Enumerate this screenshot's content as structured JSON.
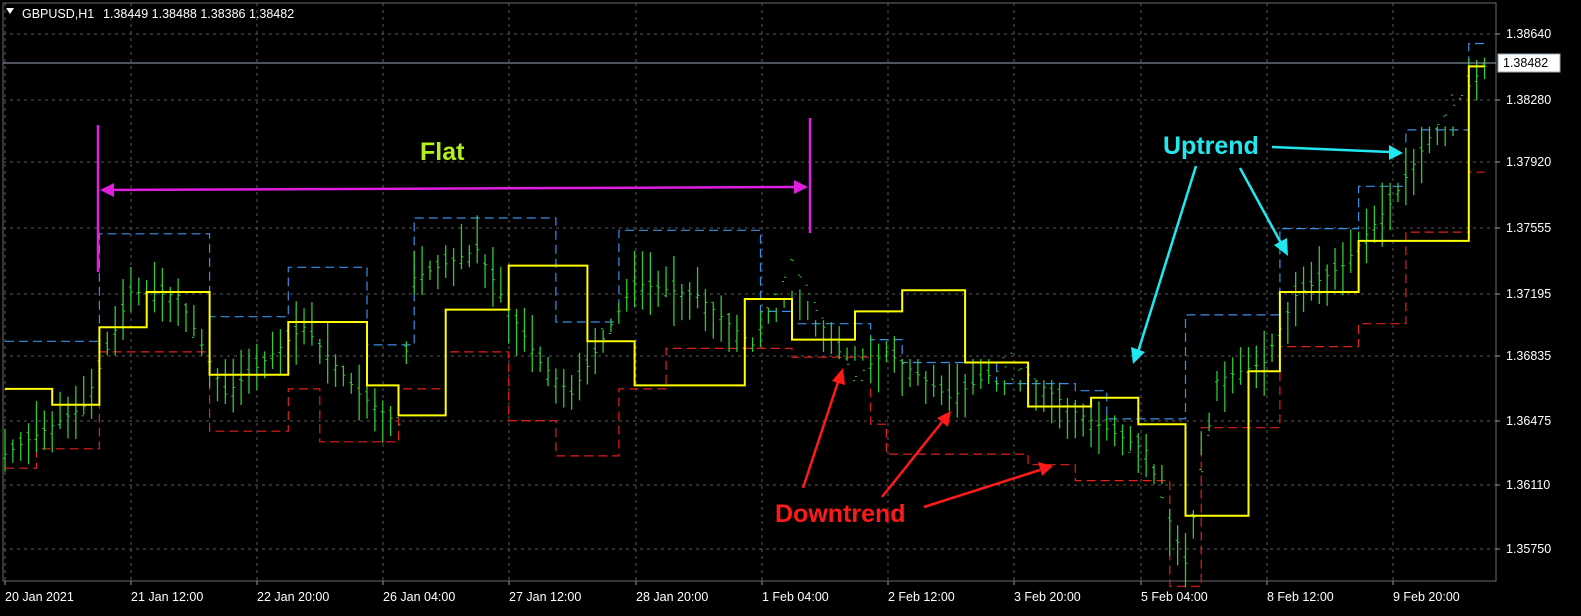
{
  "header": {
    "symbol": "GBPUSD,H1",
    "ohlc": "1.38449 1.38488 1.38386 1.38482"
  },
  "colors": {
    "background": "#000000",
    "grid": "#5a5a5a",
    "candle": "#32c832",
    "midline": "#ffff00",
    "upper_band": "#3a8ee6",
    "lower_band": "#e0201a",
    "flat_annotation": "#e01ee0",
    "flat_text": "#b4f01e",
    "uptrend": "#20e8ee",
    "downtrend": "#ff1a1a",
    "price_line": "#9aa8b8"
  },
  "chart_data": {
    "type": "line",
    "title": "GBPUSD,H1",
    "x_tick_labels": [
      "20 Jan 2021",
      "21 Jan 12:00",
      "22 Jan 20:00",
      "26 Jan 04:00",
      "27 Jan 12:00",
      "28 Jan 20:00",
      "1 Feb 04:00",
      "2 Feb 12:00",
      "3 Feb 20:00",
      "5 Feb 04:00",
      "8 Feb 12:00",
      "9 Feb 20:00"
    ],
    "y_tick_labels": [
      "1.38640",
      "1.38280",
      "1.37920",
      "1.37555",
      "1.37195",
      "1.36835",
      "1.36475",
      "1.36110",
      "1.35750"
    ],
    "ylim": [
      1.3556,
      1.3884
    ],
    "current_price": "1.38482",
    "n_bars": 189,
    "series": [
      {
        "name": "",
        "style": "step",
        "x": [
          0,
          6,
          12,
          18,
          26,
          36,
          46,
          50,
          56,
          64,
          74,
          80,
          94,
          100,
          108,
          114,
          122,
          130,
          138,
          144,
          150,
          158,
          162,
          172,
          186
        ],
        "values": [
          1.3665,
          1.3656,
          1.37,
          1.372,
          1.3673,
          1.3703,
          1.3667,
          1.365,
          1.371,
          1.3735,
          1.3692,
          1.3667,
          1.3716,
          1.3693,
          1.3709,
          1.3721,
          1.368,
          1.3655,
          1.366,
          1.3645,
          1.3593,
          1.3675,
          1.372,
          1.3749,
          1.3848
        ]
      },
      {
        "name": "",
        "style": "dashed",
        "x": [
          0,
          12,
          26,
          36,
          46,
          52,
          70,
          78,
          96,
          100,
          110,
          114,
          126,
          136,
          140,
          150,
          162,
          172,
          178,
          186
        ],
        "values": [
          1.3692,
          1.3753,
          1.3706,
          1.3734,
          1.369,
          1.3762,
          1.3703,
          1.3755,
          1.3709,
          1.3702,
          1.3693,
          1.368,
          1.3668,
          1.3664,
          1.3648,
          1.3707,
          1.3756,
          1.378,
          1.3812,
          1.3861
        ]
      },
      {
        "name": "",
        "style": "dashed",
        "x": [
          0,
          4,
          12,
          26,
          36,
          40,
          50,
          56,
          64,
          70,
          78,
          84,
          100,
          110,
          112,
          120,
          130,
          136,
          140,
          148,
          152,
          162,
          172,
          178,
          186
        ],
        "values": [
          1.362,
          1.3631,
          1.3686,
          1.3641,
          1.3665,
          1.3635,
          1.3665,
          1.3686,
          1.3647,
          1.3627,
          1.3665,
          1.3688,
          1.3683,
          1.3645,
          1.3628,
          1.3628,
          1.3622,
          1.3613,
          1.3613,
          1.3553,
          1.3643,
          1.3689,
          1.3702,
          1.3754,
          1.3788
        ]
      },
      {
        "name": "",
        "style": "price-bars",
        "x": [
          0,
          10,
          16,
          22,
          28,
          38,
          45,
          50,
          52,
          60,
          64,
          68,
          72,
          80,
          88,
          95,
          100,
          104,
          108,
          112,
          120,
          128,
          136,
          145,
          148,
          150,
          154,
          160,
          164,
          170,
          176,
          182,
          188
        ],
        "values": [
          1.3628,
          1.3655,
          1.372,
          1.3718,
          1.3662,
          1.37,
          1.3662,
          1.3645,
          1.3728,
          1.3744,
          1.371,
          1.368,
          1.3662,
          1.3725,
          1.3718,
          1.369,
          1.3738,
          1.37,
          1.3672,
          1.3686,
          1.366,
          1.368,
          1.3652,
          1.363,
          1.359,
          1.3566,
          1.367,
          1.368,
          1.3718,
          1.3735,
          1.377,
          1.3815,
          1.3848
        ]
      }
    ]
  },
  "annotations": {
    "flat_label": "Flat",
    "uptrend_label": "Uptrend",
    "downtrend_label": "Downtrend"
  }
}
